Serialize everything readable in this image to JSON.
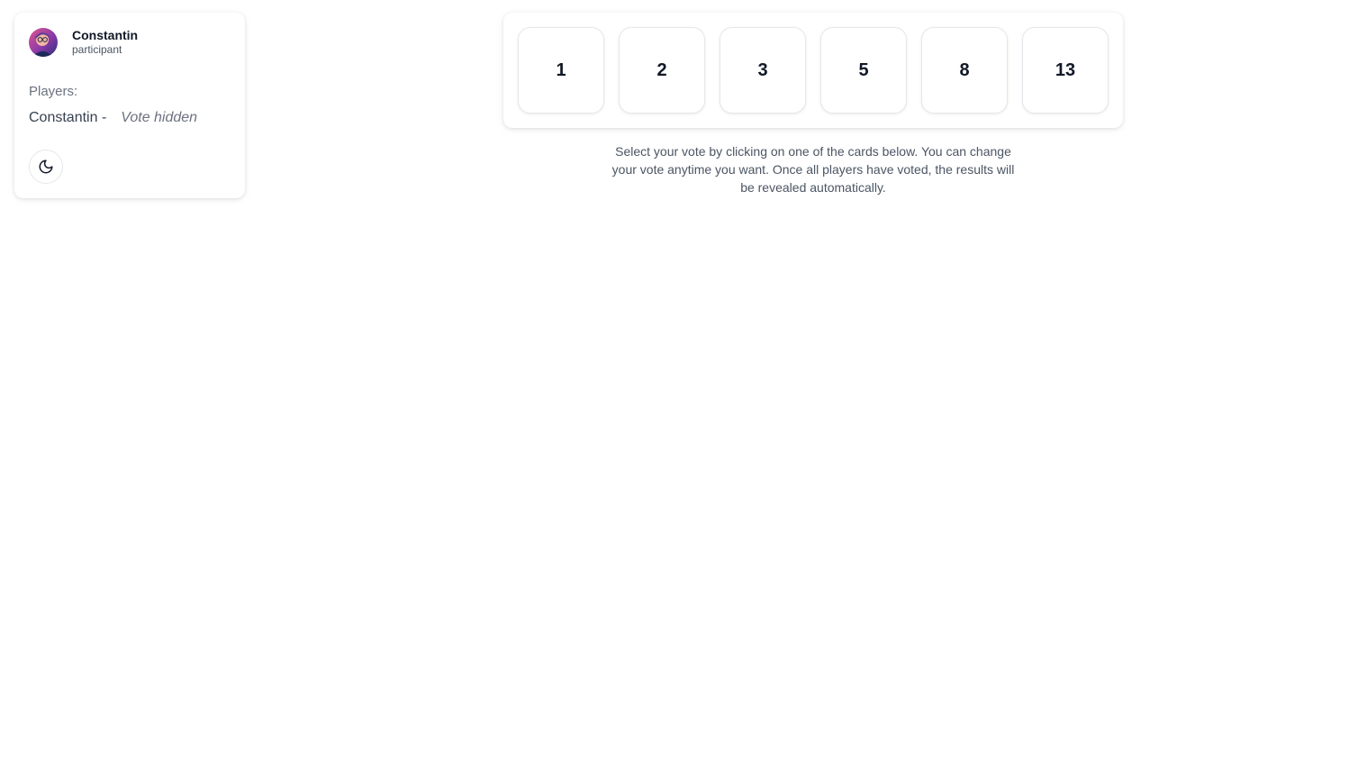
{
  "user": {
    "name": "Constantin",
    "role": "participant"
  },
  "players": {
    "heading": "Players:",
    "list": [
      {
        "name": "Constantin -",
        "status": "Vote hidden"
      }
    ]
  },
  "theme_toggle": {
    "icon": "moon-icon"
  },
  "cards": [
    "1",
    "2",
    "3",
    "5",
    "8",
    "13"
  ],
  "instructions": "Select your vote by clicking on one of the cards below. You can change your vote anytime you want. Once all players have voted, the results will be revealed automatically."
}
